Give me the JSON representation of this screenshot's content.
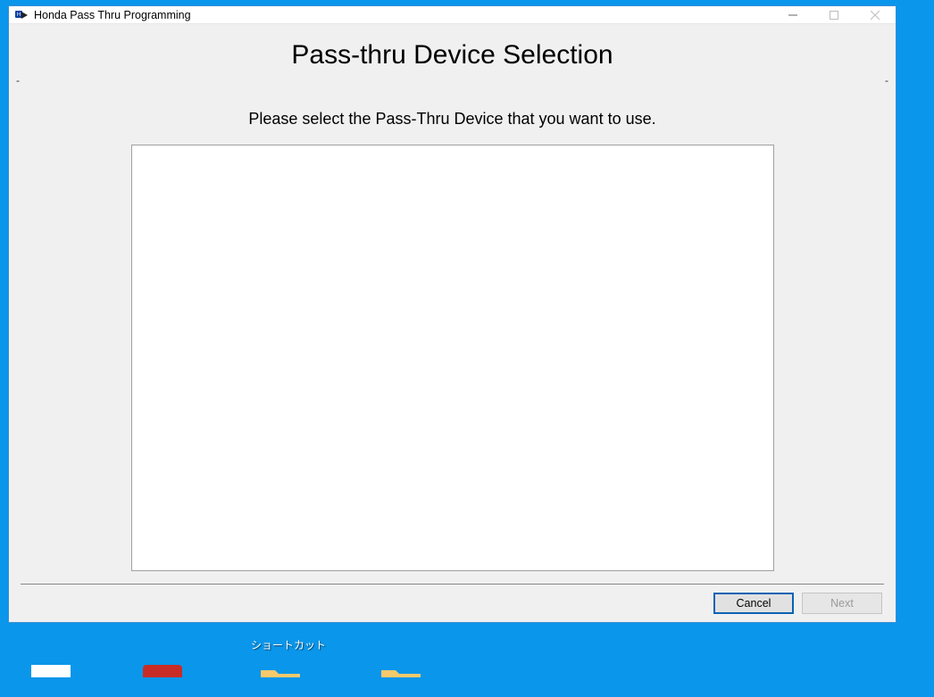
{
  "window": {
    "title": "Honda Pass Thru Programming"
  },
  "heading": "Pass-thru Device Selection",
  "dash_left": "-",
  "dash_right": "-",
  "subheading": "Please select the Pass-Thru Device that you want to use.",
  "buttons": {
    "cancel": "Cancel",
    "next": "Next"
  },
  "desktop": {
    "label1": "",
    "label2": "",
    "label3": "",
    "label4": "",
    "shortcut": "ショートカット"
  }
}
